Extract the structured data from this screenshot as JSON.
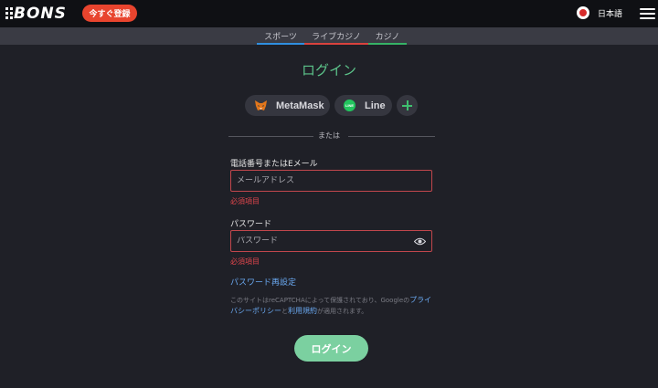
{
  "header": {
    "logo_text": "BONS",
    "signup_label": "今すぐ登録",
    "language_label": "日本語",
    "signup_color": "#e8442e"
  },
  "nav": {
    "tabs": [
      {
        "label": "スポーツ",
        "accent": "#2f8fe0"
      },
      {
        "label": "ライブカジノ",
        "accent": "#d9423d"
      },
      {
        "label": "カジノ",
        "accent": "#36b266"
      }
    ]
  },
  "login": {
    "title": "ログイン",
    "social": [
      {
        "label": "MetaMask",
        "icon": "metamask-fox-icon"
      },
      {
        "label": "Line",
        "icon": "line-icon"
      }
    ],
    "line_icon_text": "LINE",
    "or_label": "または",
    "phone_email_label": "電話番号またはEメール",
    "email_placeholder": "メールアドレス",
    "email_error": "必須項目",
    "password_label": "パスワード",
    "password_placeholder": "パスワード",
    "password_error": "必須項目",
    "reset_link": "パスワード再設定",
    "recaptcha_prefix": "このサイトはreCAPTCHAによって保護されており、Googleの",
    "privacy_link": "プライバシーポリシー",
    "recaptcha_and": "と",
    "terms_link": "利用規約",
    "recaptcha_suffix": "が適用されます。",
    "submit_label": "ログイン",
    "accent_color": "#5cc38a",
    "error_color": "#e0464c"
  }
}
